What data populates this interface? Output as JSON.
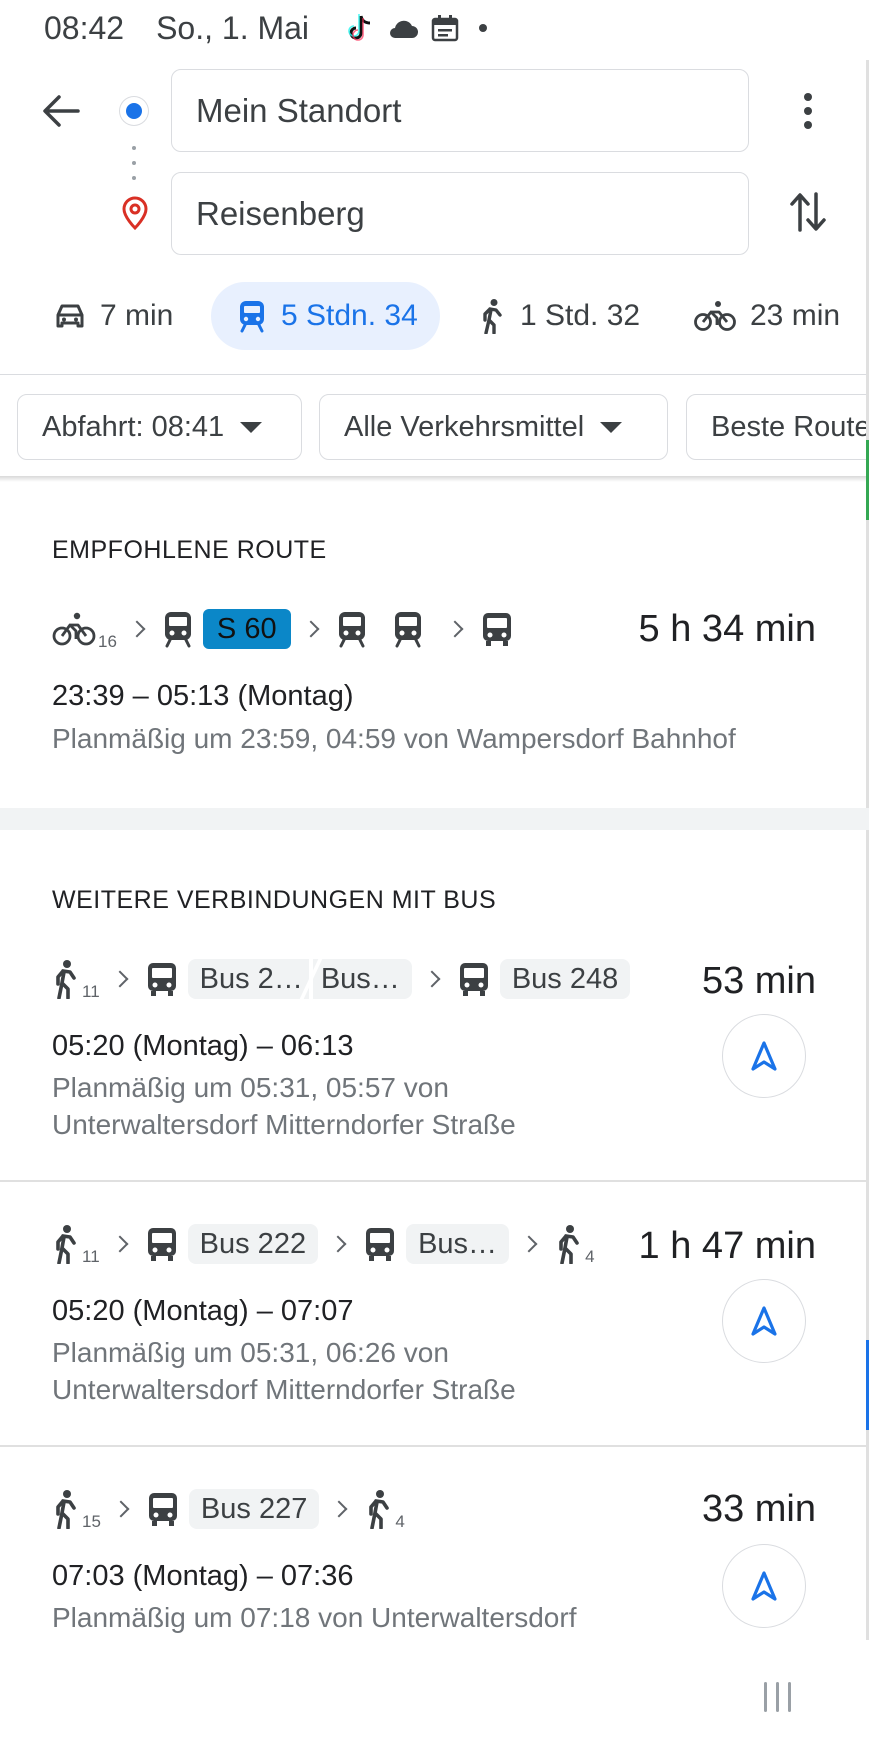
{
  "status_bar": {
    "time": "08:42",
    "date": "So., 1. Mai"
  },
  "search": {
    "origin": "Mein Standort",
    "destination": "Reisenberg"
  },
  "modes": [
    {
      "id": "car",
      "label": "7 min",
      "icon": "car-icon",
      "active": false
    },
    {
      "id": "transit",
      "label": "5 Stdn. 34",
      "icon": "train-icon",
      "active": true
    },
    {
      "id": "walk",
      "label": "1 Std. 32",
      "icon": "walk-icon",
      "active": false
    },
    {
      "id": "bike",
      "label": "23 min",
      "icon": "bike-icon",
      "active": false
    }
  ],
  "filters": {
    "departure": "Abfahrt: 08:41",
    "transport": "Alle Verkehrsmittel",
    "sort": "Beste Route"
  },
  "recommended": {
    "heading": "EMPFOHLENE ROUTE",
    "bike_minutes": "16",
    "line": "S 60",
    "duration": "5 h 34 min",
    "times": "23:39 – 05:13 (Montag)",
    "schedule": "Planmäßig um 23:59, 04:59 von Wampersdorf Bahnhof"
  },
  "more": {
    "heading": "WEITERE VERBINDUNGEN MIT BUS",
    "routes": [
      {
        "walk_start": "11",
        "line_a": "Bus 2…",
        "line_b": "Bus…",
        "line_c": "Bus 248",
        "duration": "53 min",
        "times": "05:20 (Montag) – 06:13",
        "schedule_1": "Planmäßig um 05:31, 05:57 von",
        "schedule_2": "Unterwaltersdorf Mitterndorfer Straße"
      },
      {
        "walk_start": "11",
        "line_a": "Bus 222",
        "line_b": "Bus…",
        "walk_end": "4",
        "duration": "1 h 47 min",
        "times": "05:20 (Montag) – 07:07",
        "schedule_1": "Planmäßig um 05:31, 06:26 von",
        "schedule_2": "Unterwaltersdorf Mitterndorfer Straße"
      },
      {
        "walk_start": "15",
        "line_a": "Bus 227",
        "walk_end": "4",
        "duration": "33 min",
        "times": "07:03 (Montag) – 07:36",
        "schedule_1": "Planmäßig um 07:18 von Unterwaltersdorf"
      }
    ]
  },
  "colors": {
    "accent": "#1a73e8",
    "s60_badge": "#0b87c8",
    "pin": "#d93025"
  }
}
